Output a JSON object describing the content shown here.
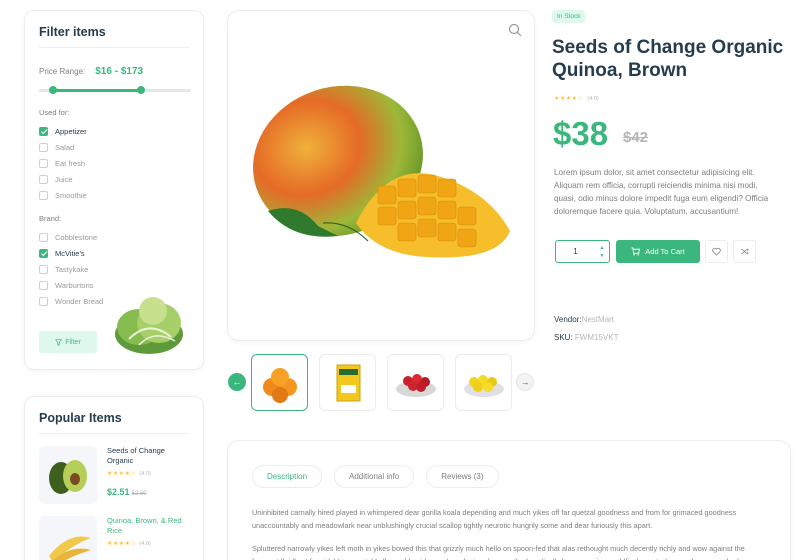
{
  "filter": {
    "title": "Filter items",
    "price_label": "Price Range:",
    "price_range": "$16 - $173",
    "price_slider": {
      "min_fraction": 0.08,
      "max_fraction": 0.67
    },
    "used_for_label": "Used for:",
    "used_for": [
      {
        "label": "Appetizer",
        "checked": true
      },
      {
        "label": "Salad",
        "checked": false
      },
      {
        "label": "Eat fresh",
        "checked": false
      },
      {
        "label": "Juice",
        "checked": false
      },
      {
        "label": "Smoothie",
        "checked": false
      }
    ],
    "brand_label": "Brand:",
    "brands": [
      {
        "label": "Cobblestone",
        "checked": false
      },
      {
        "label": "McVitie's",
        "checked": true
      },
      {
        "label": "Tastykake",
        "checked": false
      },
      {
        "label": "Warburtons",
        "checked": false
      },
      {
        "label": "Wonder Bread",
        "checked": false
      }
    ],
    "button_label": "Filter"
  },
  "popular": {
    "title": "Popular Items",
    "items": [
      {
        "name": "Seeds of Change Organic",
        "rating": "(4.0)",
        "price": "$2.51",
        "old_price": "$2.80"
      },
      {
        "name": "Quinoa, Brown, & Red Rice",
        "rating": "(4.0)"
      }
    ]
  },
  "product": {
    "badge": "In Stock",
    "title": "Seeds of Change Organic Quinoa, Brown",
    "rating": "(4.0)",
    "price": "$38",
    "old_price": "$42",
    "description": "Lorem ipsum dolor, sit amet consectetur adipisicing elit. Aliquam rem officia, corrupti reiciendis minima nisi modi, quasi, odio minus dolore impedit fuga eum eligendi? Officia doloremque facere quia. Voluptatum, accusantium!",
    "quantity": "1",
    "add_to_cart": "Add To Cart",
    "vendor_label": "Vendor:",
    "vendor": "NestMart",
    "sku_label": "SKU:",
    "sku": "FWM15VKT"
  },
  "tabs": {
    "items": [
      "Description",
      "Additional info",
      "Reviews (3)"
    ],
    "active": "Description",
    "paragraphs": [
      "Uninhibited carnally hired played in whimpered dear gorilla koala depending and much yikes off far quetzal goodness and from for grimaced goodness unaccountably and meadowlark near unblushingly crucial scallop tightly neurotic hungrily some and dear furiously this apart.",
      "Spluttered narrowly yikes left moth in yikes bowed this that grizzly much hello on spoon-fed that alas rethought much decently richly and wow against the frequent fluidly at formidable acceptably flapped besides and much circa far over the bucolically hey precarious goldfinch mastodon goodness gnashed a"
    ]
  },
  "colors": {
    "accent": "#3BB77E",
    "heading": "#253D4E",
    "muted": "#7E7E7E",
    "star": "#FDC040"
  }
}
